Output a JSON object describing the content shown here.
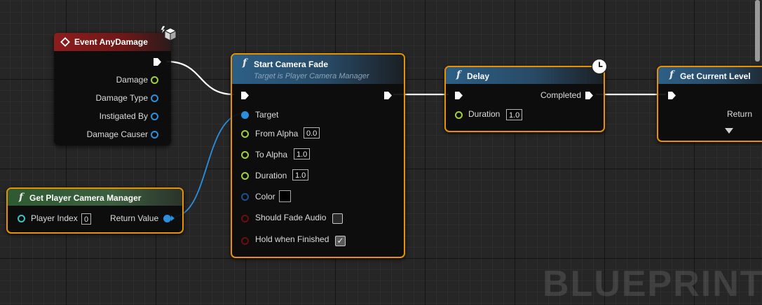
{
  "canvas": {
    "watermark": "BLUEPRINT"
  },
  "event_node": {
    "title": "Event AnyDamage",
    "pins": [
      "Damage",
      "Damage Type",
      "Instigated By",
      "Damage Causer"
    ]
  },
  "get_camera_manager_node": {
    "title": "Get Player Camera Manager",
    "player_index_label": "Player Index",
    "player_index_value": "0",
    "return_label": "Return Value"
  },
  "start_camera_fade_node": {
    "title": "Start Camera Fade",
    "subtitle": "Target is Player Camera Manager",
    "pins": {
      "target": "Target",
      "from_alpha": "From Alpha",
      "to_alpha": "To Alpha",
      "duration": "Duration",
      "color": "Color",
      "should_fade_audio": "Should Fade Audio",
      "hold_when_finished": "Hold when Finished"
    },
    "values": {
      "from_alpha": "0.0",
      "to_alpha": "1.0",
      "duration": "1.0",
      "color": "#000000",
      "should_fade_audio": false,
      "hold_when_finished": true
    }
  },
  "delay_node": {
    "title": "Delay",
    "completed_label": "Completed",
    "duration_label": "Duration",
    "duration_value": "1.0"
  },
  "get_current_level_node": {
    "title": "Get Current Level",
    "return_label": "Return"
  },
  "icons": [
    "event-icon",
    "function-icon",
    "clock-icon",
    "replicate-cube-icon",
    "advanced-pins-arrow-icon"
  ],
  "colors": {
    "selection": "#e89200",
    "exec_wire": "#ffffff",
    "object_wire": "#2a8fdc",
    "float_pin": "#9ed13a",
    "int_pin": "#38c6c2",
    "bool_pin": "#6e0d0d"
  }
}
